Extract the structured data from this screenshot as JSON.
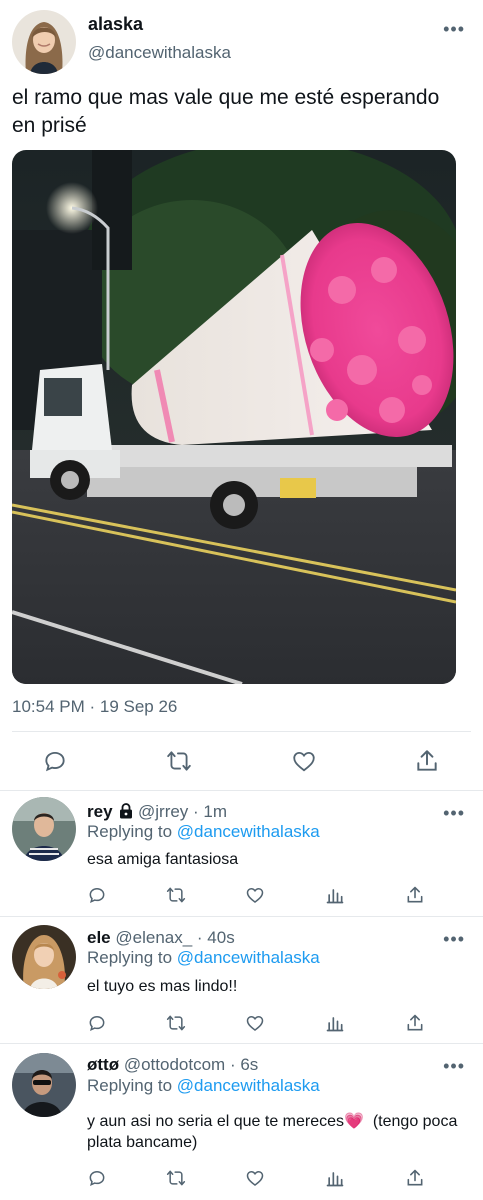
{
  "main_tweet": {
    "name": "alaska",
    "handle": "@dancewithalaska",
    "more_icon": "more-icon",
    "text": "el ramo que mas vale que me esté esperando en prisé",
    "media": "photo of a truck carrying a giant pink flower bouquet at night",
    "timestamp": "10:54 PM · 19 Sep 26",
    "actions": [
      "reply-icon",
      "retweet-icon",
      "like-icon",
      "share-icon"
    ]
  },
  "replies": [
    {
      "name": "rey",
      "protected": true,
      "handle": "@jrrey",
      "time": "· 1m",
      "replying_label": "Replying to ",
      "replying_to": "@dancewithalaska",
      "text": "esa amiga fantasiosa"
    },
    {
      "name": "ele",
      "protected": false,
      "handle": "@elenax_",
      "time": "· 40s",
      "replying_label": "Replying to ",
      "replying_to": "@dancewithalaska",
      "text": "el tuyo es mas lindo!!"
    },
    {
      "name": "øttø",
      "protected": false,
      "handle": "@ottodotcom",
      "time": "· 6s",
      "replying_label": "Replying to ",
      "replying_to": "@dancewithalaska",
      "text_before": "y aun asi no seria el que te mereces",
      "emoji": "💗",
      "text_after": "  (tengo poca plata bancame)"
    }
  ],
  "colors": {
    "text": "#0f1419",
    "secondary": "#536471",
    "link": "#1d9bf0",
    "divider": "#e6e9ec"
  }
}
